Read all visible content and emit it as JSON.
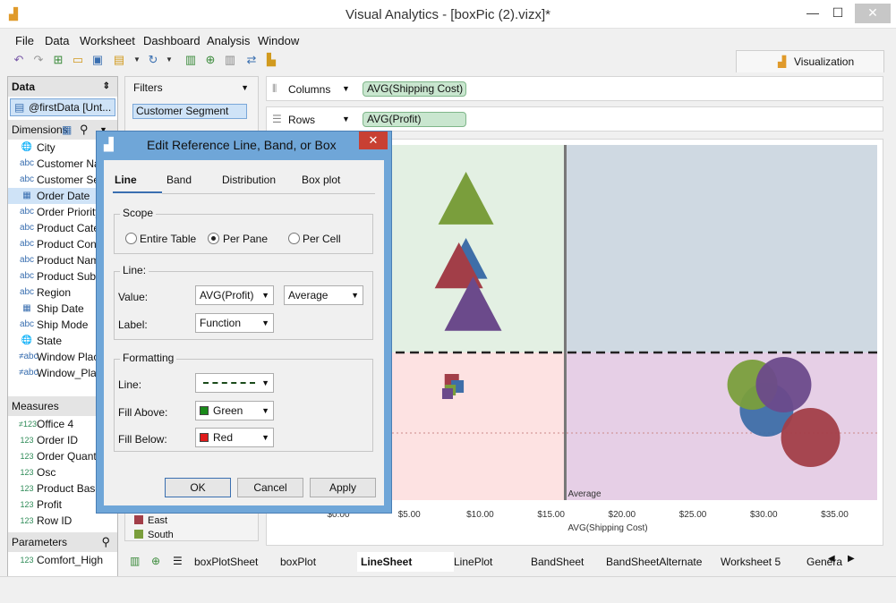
{
  "window": {
    "title": "Visual Analytics - [boxPic (2).vizx]*",
    "min": "—",
    "max": "☐",
    "close": "✕"
  },
  "menu": [
    "File",
    "Data",
    "Worksheet",
    "Dashboard",
    "Analysis",
    "Window"
  ],
  "viz_tab": "Visualization",
  "data_pane": {
    "title": "Data",
    "source": "@firstData [Unt...",
    "dimensions_title": "Dimensions",
    "dimensions": [
      {
        "icon": "globe-icon",
        "glyph": "🌐",
        "label": "City"
      },
      {
        "icon": "abc-icon",
        "glyph": "abc",
        "label": "Customer Name"
      },
      {
        "icon": "abc-icon",
        "glyph": "abc",
        "label": "Customer Segment"
      },
      {
        "icon": "date-icon",
        "glyph": "▦",
        "label": "Order Date"
      },
      {
        "icon": "abc-icon",
        "glyph": "abc",
        "label": "Order Priority"
      },
      {
        "icon": "abc-icon",
        "glyph": "abc",
        "label": "Product Category"
      },
      {
        "icon": "abc-icon",
        "glyph": "abc",
        "label": "Product Container"
      },
      {
        "icon": "abc-icon",
        "glyph": "abc",
        "label": "Product Name"
      },
      {
        "icon": "abc-icon",
        "glyph": "abc",
        "label": "Product Sub-Category"
      },
      {
        "icon": "abc-icon",
        "glyph": "abc",
        "label": "Region"
      },
      {
        "icon": "date-icon",
        "glyph": "▦",
        "label": "Ship Date"
      },
      {
        "icon": "abc-icon",
        "glyph": "abc",
        "label": "Ship Mode"
      },
      {
        "icon": "globe-icon",
        "glyph": "🌐",
        "label": "State"
      },
      {
        "icon": "calc-abc-icon",
        "glyph": "≠abc",
        "label": "Window Placement"
      },
      {
        "icon": "calc-abc-icon",
        "glyph": "≠abc",
        "label": "Window_Placement"
      }
    ],
    "measures_title": "Measures",
    "measures": [
      {
        "glyph": "≠123",
        "label": "Office 4"
      },
      {
        "glyph": "123",
        "label": "Order ID"
      },
      {
        "glyph": "123",
        "label": "Order Quantity"
      },
      {
        "glyph": "123",
        "label": "Osc"
      },
      {
        "glyph": "123",
        "label": "Product Base Margin"
      },
      {
        "glyph": "123",
        "label": "Profit"
      },
      {
        "glyph": "123",
        "label": "Row ID"
      }
    ],
    "parameters_title": "Parameters",
    "parameters": [
      {
        "glyph": "123",
        "label": "Comfort_High"
      }
    ]
  },
  "filters": {
    "title": "Filters",
    "items": [
      "Customer Segment"
    ]
  },
  "legend_items": [
    {
      "label": "East",
      "color": "#a23e48"
    },
    {
      "label": "South",
      "color": "#7a9e3c"
    }
  ],
  "shelves": {
    "columns_label": "Columns",
    "columns_pill": "AVG(Shipping Cost)",
    "rows_label": "Rows",
    "rows_pill": "AVG(Profit)"
  },
  "chart_data": {
    "type": "scatter",
    "xlabel": "AVG(Shipping Cost)",
    "x_ticks": [
      "$0.00",
      "$5.00",
      "$10.00",
      "$15.00",
      "$20.00",
      "$25.00",
      "$30.00",
      "$35.00"
    ],
    "xlim": [
      0,
      38
    ],
    "reference_line_x": {
      "value": 16,
      "label": "Average"
    },
    "reference_line_y": {
      "style": "dashed"
    },
    "fill_above": "#e3f0e3",
    "fill_below": "#fde2e2",
    "right_above": "#cfd9e2",
    "right_below": "#e6cfe6",
    "marks": [
      {
        "shape": "triangle",
        "x": 9,
        "color": "#7a9e3c"
      },
      {
        "shape": "triangle",
        "x": 9,
        "color": "#3e6ea8"
      },
      {
        "shape": "triangle",
        "x": 8.5,
        "color": "#a23e48"
      },
      {
        "shape": "triangle",
        "x": 9.5,
        "color": "#6b4a8b"
      },
      {
        "shape": "square",
        "x": 8,
        "color": "#a23e48"
      },
      {
        "shape": "square",
        "x": 8.4,
        "color": "#3e6ea8"
      },
      {
        "shape": "square",
        "x": 7.9,
        "color": "#7a9e3c"
      },
      {
        "shape": "square",
        "x": 7.7,
        "color": "#6b4a8b"
      },
      {
        "shape": "circle",
        "x": 30.2,
        "color": "#3e6ea8"
      },
      {
        "shape": "circle",
        "x": 29.2,
        "color": "#7a9e3c"
      },
      {
        "shape": "circle",
        "x": 31.4,
        "color": "#6b4a8b"
      },
      {
        "shape": "circle",
        "x": 33.3,
        "color": "#a23e48"
      }
    ]
  },
  "sheet_tabs": [
    "boxPlotSheet",
    "boxPlot",
    "LineSheet",
    "LinePlot",
    "BandSheet",
    "BandSheetAlternate",
    "Worksheet 5",
    "General"
  ],
  "dialog": {
    "title": "Edit Reference Line, Band, or Box",
    "tabs": [
      "Line",
      "Band",
      "Distribution",
      "Box plot"
    ],
    "scope_title": "Scope",
    "scope_options": [
      "Entire Table",
      "Per Pane",
      "Per Cell"
    ],
    "line_title": "Line:",
    "value_label": "Value:",
    "value_field": "AVG(Profit)",
    "value_agg": "Average",
    "label_label": "Label:",
    "label_value": "Function",
    "formatting_title": "Formatting",
    "fmt_line_label": "Line:",
    "fill_above_label": "Fill Above:",
    "fill_above_value": "Green",
    "fill_above_color": "#1a8a1a",
    "fill_below_label": "Fill Below:",
    "fill_below_value": "Red",
    "fill_below_color": "#e01b1b",
    "ok": "OK",
    "cancel": "Cancel",
    "apply": "Apply"
  }
}
